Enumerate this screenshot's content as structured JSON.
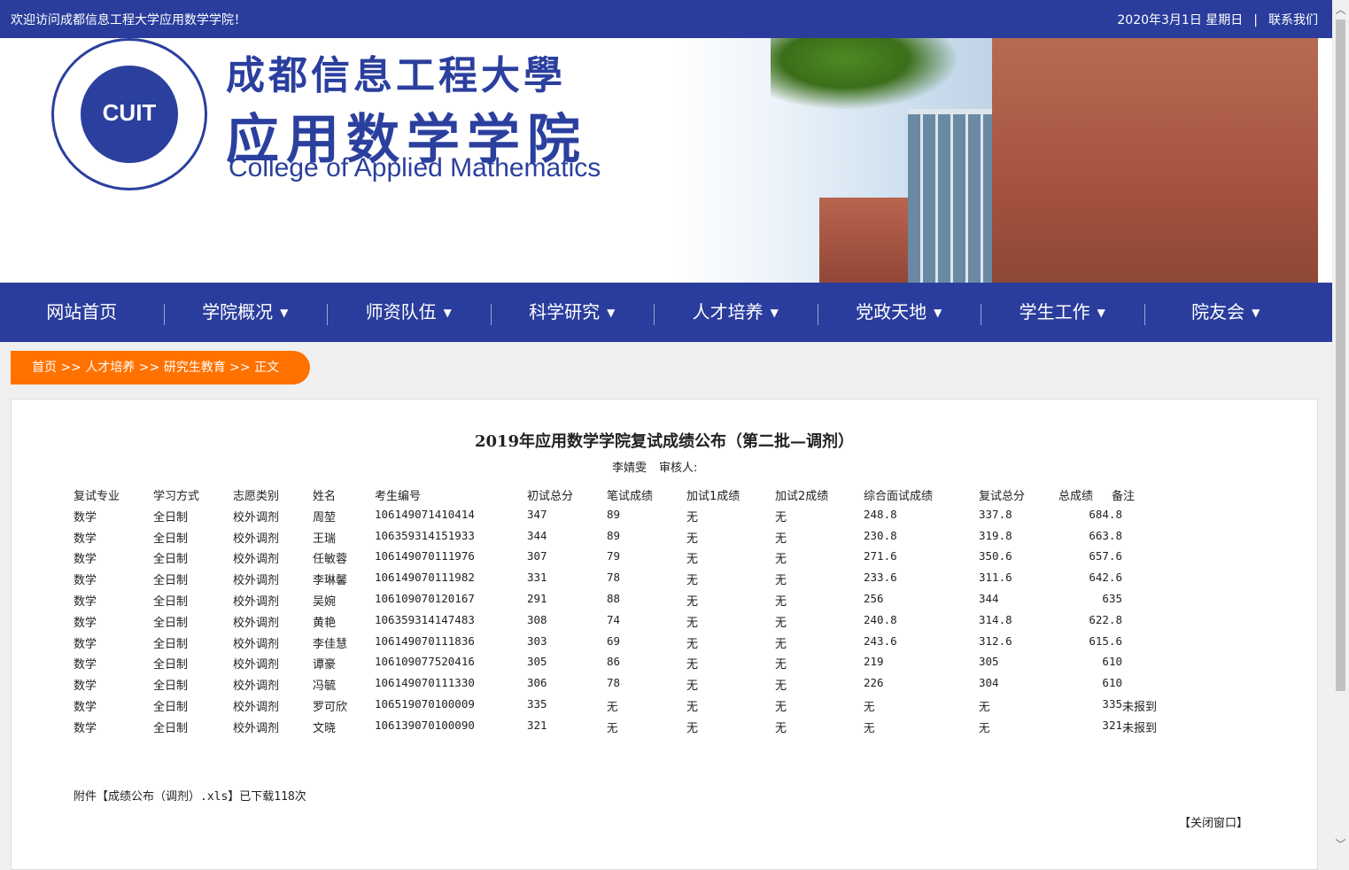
{
  "topbar": {
    "welcome": "欢迎访问成都信息工程大学应用数学学院！",
    "date": "2020年3月1日 星期日",
    "separator": "|",
    "contact": "联系我们"
  },
  "banner": {
    "seal_text": "CUIT",
    "university_cn": "成都信息工程大學",
    "college_cn": "应用数学学院",
    "college_en": "College of Applied Mathematics"
  },
  "nav": {
    "items": [
      {
        "label": "网站首页",
        "has_dropdown": false
      },
      {
        "label": "学院概况",
        "has_dropdown": true
      },
      {
        "label": "师资队伍",
        "has_dropdown": true
      },
      {
        "label": "科学研究",
        "has_dropdown": true
      },
      {
        "label": "人才培养",
        "has_dropdown": true
      },
      {
        "label": "党政天地",
        "has_dropdown": true
      },
      {
        "label": "学生工作",
        "has_dropdown": true
      },
      {
        "label": "院友会",
        "has_dropdown": true
      }
    ],
    "chevron": "⌄"
  },
  "breadcrumb": {
    "text": "首页 >> 人才培养 >> 研究生教育 >> 正文"
  },
  "article": {
    "title": "2019年应用数学学院复试成绩公布（第二批—调剂）",
    "author": "李婧雯",
    "reviewer": "审核人:",
    "table": {
      "headers": [
        "复试专业",
        "学习方式",
        "志愿类别",
        "姓名",
        "考生编号",
        "初试总分",
        "笔试成绩",
        "加试1成绩",
        "加试2成绩",
        "综合面试成绩",
        "复试总分",
        "总成绩",
        "备注"
      ],
      "rows": [
        [
          "数学",
          "全日制",
          "校外调剂",
          "周堃",
          "106149071410414",
          "347",
          "89",
          "无",
          "无",
          "248.8",
          "337.8",
          "684.8",
          ""
        ],
        [
          "数学",
          "全日制",
          "校外调剂",
          "王瑞",
          "106359314151933",
          "344",
          "89",
          "无",
          "无",
          "230.8",
          "319.8",
          "663.8",
          ""
        ],
        [
          "数学",
          "全日制",
          "校外调剂",
          "任敏蓉",
          "106149070111976",
          "307",
          "79",
          "无",
          "无",
          "271.6",
          "350.6",
          "657.6",
          ""
        ],
        [
          "数学",
          "全日制",
          "校外调剂",
          "李琳馨",
          "106149070111982",
          "331",
          "78",
          "无",
          "无",
          "233.6",
          "311.6",
          "642.6",
          ""
        ],
        [
          "数学",
          "全日制",
          "校外调剂",
          "吴婉",
          "106109070120167",
          "291",
          "88",
          "无",
          "无",
          "256",
          "344",
          "635",
          ""
        ],
        [
          "数学",
          "全日制",
          "校外调剂",
          "黄艳",
          "106359314147483",
          "308",
          "74",
          "无",
          "无",
          "240.8",
          "314.8",
          "622.8",
          ""
        ],
        [
          "数学",
          "全日制",
          "校外调剂",
          "李佳慧",
          "106149070111836",
          "303",
          "69",
          "无",
          "无",
          "243.6",
          "312.6",
          "615.6",
          ""
        ],
        [
          "数学",
          "全日制",
          "校外调剂",
          "谭豪",
          "106109077520416",
          "305",
          "86",
          "无",
          "无",
          "219",
          "305",
          "610",
          ""
        ],
        [
          "数学",
          "全日制",
          "校外调剂",
          "冯毓",
          "106149070111330",
          "306",
          "78",
          "无",
          "无",
          "226",
          "304",
          "610",
          ""
        ],
        [
          "数学",
          "全日制",
          "校外调剂",
          "罗可欣",
          "106519070100009",
          "335",
          "无",
          "无",
          "无",
          "无",
          "无",
          "335",
          "未报到"
        ],
        [
          "数学",
          "全日制",
          "校外调剂",
          "文晓",
          "106139070100090",
          "321",
          "无",
          "无",
          "无",
          "无",
          "无",
          "321",
          "未报到"
        ]
      ]
    },
    "attachment": "附件【成绩公布（调剂）.xls】已下载118次",
    "close": "【关闭窗口】"
  },
  "colors": {
    "primary": "#2a3d9c",
    "accent": "#ff7200"
  }
}
